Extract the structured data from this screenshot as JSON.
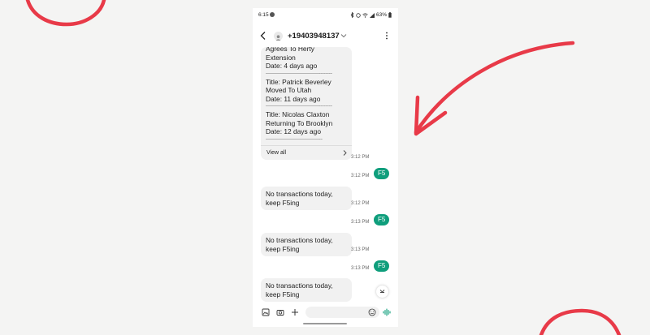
{
  "status_bar": {
    "time": "6:15",
    "battery": "63%"
  },
  "header": {
    "contact": "+19403948137"
  },
  "news": {
    "lines": [
      {
        "text": "Agrees To Herty",
        "kind": "line"
      },
      {
        "text": "Extension",
        "kind": "line"
      },
      {
        "text": "Date: 4 days ago",
        "kind": "line"
      },
      {
        "text": "-----------------------------------------",
        "kind": "sep"
      },
      {
        "text": "Title: Patrick Beverley",
        "kind": "line"
      },
      {
        "text": "Moved To Utah",
        "kind": "line"
      },
      {
        "text": "Date: 11 days ago",
        "kind": "line"
      },
      {
        "text": "-----------------------------------------",
        "kind": "sep"
      },
      {
        "text": "Title: Nicolas Claxton",
        "kind": "line"
      },
      {
        "text": "Returning To Brooklyn",
        "kind": "line"
      },
      {
        "text": "Date: 12 days ago",
        "kind": "line"
      },
      {
        "text": "-----------------------------------",
        "kind": "sep"
      }
    ],
    "view_all": "View all",
    "time": "3:12 PM"
  },
  "messages": [
    {
      "dir": "out",
      "text": "F5",
      "time": "3:12 PM"
    },
    {
      "dir": "in",
      "text": "No transactions today, keep F5ing",
      "time": "3:12 PM"
    },
    {
      "dir": "out",
      "text": "F5",
      "time": "3:13 PM"
    },
    {
      "dir": "in",
      "text": "No transactions today, keep F5ing",
      "time": "3:13 PM"
    },
    {
      "dir": "out",
      "text": "F5",
      "time": "3:13 PM"
    },
    {
      "dir": "in",
      "text": "No transactions today, keep F5ing",
      "time": ""
    }
  ],
  "colors": {
    "sent_bubble": "#0f9e7c",
    "annotation": "#e83a48",
    "received_bubble": "#f1f1f1"
  }
}
